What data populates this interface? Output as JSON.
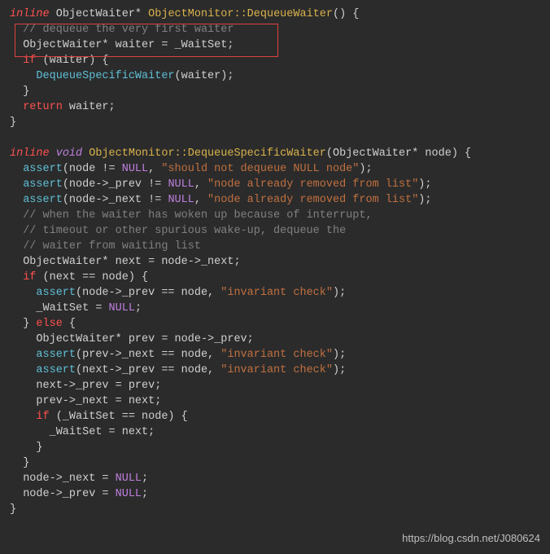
{
  "func1": {
    "sig_inline": "inline",
    "sig_ret": "ObjectWaiter*",
    "sig_name": "ObjectMonitor::DequeueWaiter",
    "sig_rest": "() {",
    "comment1": "// dequeue the very first waiter",
    "line1": "ObjectWaiter* waiter = _WaitSet;",
    "if_kw": "if",
    "if_rest": " (waiter) {",
    "call_name": "DequeueSpecificWaiter",
    "call_rest": "(waiter);",
    "close1": "}",
    "ret_kw": "return",
    "ret_rest": " waiter;",
    "close2": "}"
  },
  "func2": {
    "sig_inline": "inline",
    "sig_void": "void",
    "sig_name": "ObjectMonitor::DequeueSpecificWaiter",
    "sig_rest": "(ObjectWaiter* node) {",
    "assert_kw": "assert",
    "a1_mid": "(node != ",
    "null": "NULL",
    "a1_str": "\"should not dequeue NULL node\"",
    "a1_end": ");",
    "a2_mid": "(node->_prev != ",
    "a2_str": "\"node already removed from list\"",
    "a3_mid": "(node->_next != ",
    "a3_str": "\"node already removed from list\"",
    "comment1": "// when the waiter has woken up because of interrupt,",
    "comment2": "// timeout or other spurious wake-up, dequeue the",
    "comment3": "// waiter from waiting list",
    "line_next": "ObjectWaiter* next = node->_next;",
    "if_kw": "if",
    "if_rest": " (next == node) {",
    "a4_mid": "(node->_prev == node, ",
    "a4_str": "\"invariant check\"",
    "a4_end": ");",
    "ws_null_a": "_WaitSet = ",
    "ws_null_b": ";",
    "close_if": "}",
    "else_kw": "else",
    "else_rest": " {",
    "line_prev": "ObjectWaiter* prev = node->_prev;",
    "a5_mid": "(prev->_next == node, ",
    "a5_str": "\"invariant check\"",
    "a6_mid": "(next->_prev == node, ",
    "a6_str": "\"invariant check\"",
    "np": "next->_prev = prev;",
    "pn": "prev->_next = next;",
    "if2_kw": "if",
    "if2_rest": " (_WaitSet == node) {",
    "ws_next": "_WaitSet = next;",
    "close_if2": "}",
    "close_else": "}",
    "nn_a": "node->_next = ",
    "npv_a": "node->_prev = ",
    "semi": ";",
    "close_fn": "}"
  },
  "watermark": "https://blog.csdn.net/J080624"
}
